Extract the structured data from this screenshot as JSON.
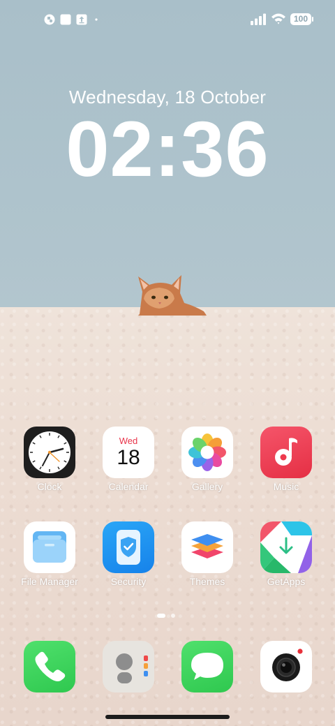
{
  "status_bar": {
    "battery": "100",
    "left_icons": [
      "app-notification-icon",
      "square-notification-icon",
      "upload-notification-icon",
      "dot-icon"
    ],
    "right_icons": [
      "signal-icon",
      "wifi-icon",
      "battery-icon"
    ]
  },
  "lock": {
    "date": "Wednesday, 18 October",
    "time": "02:36"
  },
  "calendar_icon": {
    "day": "Wed",
    "date": "18"
  },
  "apps_row1": [
    {
      "label": "Clock"
    },
    {
      "label": "Calendar"
    },
    {
      "label": "Gallery"
    },
    {
      "label": "Music"
    }
  ],
  "apps_row2": [
    {
      "label": "File Manager"
    },
    {
      "label": "Security"
    },
    {
      "label": "Themes"
    },
    {
      "label": "GetApps"
    }
  ],
  "dock": [
    "phone-icon",
    "contacts-icon",
    "messages-icon",
    "camera-icon"
  ],
  "page_indicator": {
    "pages": 2,
    "current": 1
  },
  "colors": {
    "music": "#ee3a4d",
    "phone": "#34d158",
    "messages": "#34d158",
    "security": "#1a8ff0",
    "calendar_day": "#e8344a"
  }
}
